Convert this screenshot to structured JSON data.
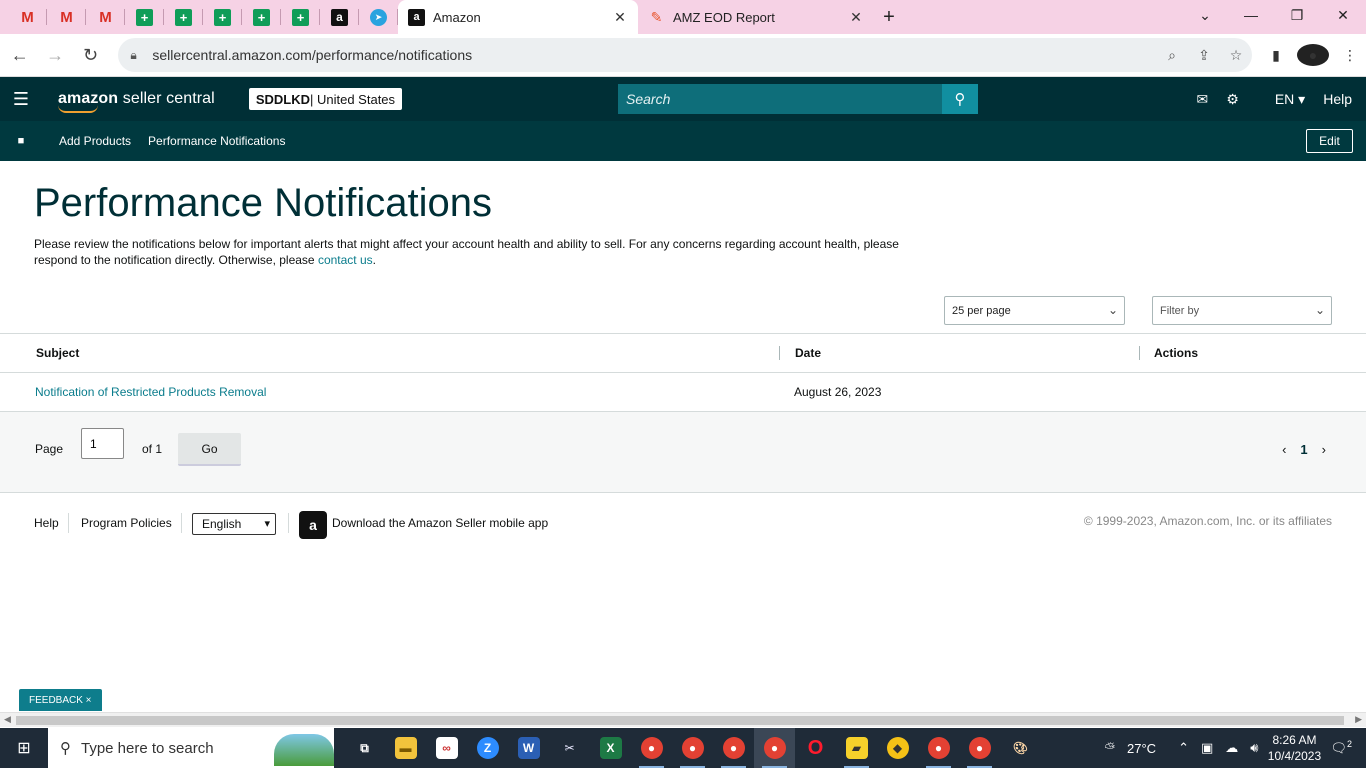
{
  "browser": {
    "pinned_tabs": [
      {
        "icon": "gmail-icon",
        "glyph": "M"
      },
      {
        "icon": "gmail-icon",
        "glyph": "M"
      },
      {
        "icon": "gmail-icon",
        "glyph": "M"
      },
      {
        "icon": "sheets-icon",
        "glyph": "+"
      },
      {
        "icon": "sheets-icon",
        "glyph": "+"
      },
      {
        "icon": "sheets-icon",
        "glyph": "+"
      },
      {
        "icon": "sheets-icon",
        "glyph": "+"
      },
      {
        "icon": "sheets-icon",
        "glyph": "+"
      },
      {
        "icon": "amazon-icon",
        "glyph": "a"
      },
      {
        "icon": "telegram-icon",
        "glyph": "➤"
      }
    ],
    "tabs": [
      {
        "title": "Amazon",
        "active": true
      },
      {
        "title": "AMZ EOD Report",
        "active": false
      }
    ],
    "url": "sellercentral.amazon.com/performance/notifications"
  },
  "header": {
    "brand_amazon": "amazon",
    "brand_seller": " seller central",
    "account_code": "SDDLKD",
    "account_region": " | United States",
    "search_placeholder": "Search",
    "lang": "EN",
    "help": "Help"
  },
  "subnav": {
    "links": [
      "Add Products",
      "Performance Notifications"
    ],
    "edit": "Edit"
  },
  "page": {
    "title": "Performance Notifications",
    "description": "Please review the notifications below for important alerts that might affect your account health and ability to sell. For any concerns regarding account health, please respond to the notification directly. Otherwise, please ",
    "contact_link": "contact us",
    "description_end": ".",
    "per_page": "25 per page",
    "filter_placeholder": "Filter by"
  },
  "table": {
    "columns": [
      "Subject",
      "Date",
      "Actions"
    ],
    "rows": [
      {
        "subject": "Notification of Restricted Products Removal",
        "date": "August 26, 2023",
        "actions": ""
      }
    ]
  },
  "pager": {
    "page_label": "Page",
    "page_value": "1",
    "of_label": "of 1",
    "go": "Go",
    "current": "1"
  },
  "footer": {
    "help": "Help",
    "policies": "Program Policies",
    "language": "English",
    "app_text": "Download the Amazon Seller mobile app",
    "copyright": "© 1999-2023, Amazon.com, Inc. or its affiliates"
  },
  "feedback": "FEEDBACK ×",
  "taskbar": {
    "search_placeholder": "Type here to search",
    "temperature": "27°C",
    "time": "8:26 AM",
    "date": "10/4/2023",
    "notifications": "2"
  },
  "colors": {
    "header_bg": "#002f36",
    "subnav_bg": "#00393f",
    "search_bg": "#0e6e7a",
    "link": "#0a7c8c",
    "tab_strip": "#f6d2e5"
  }
}
